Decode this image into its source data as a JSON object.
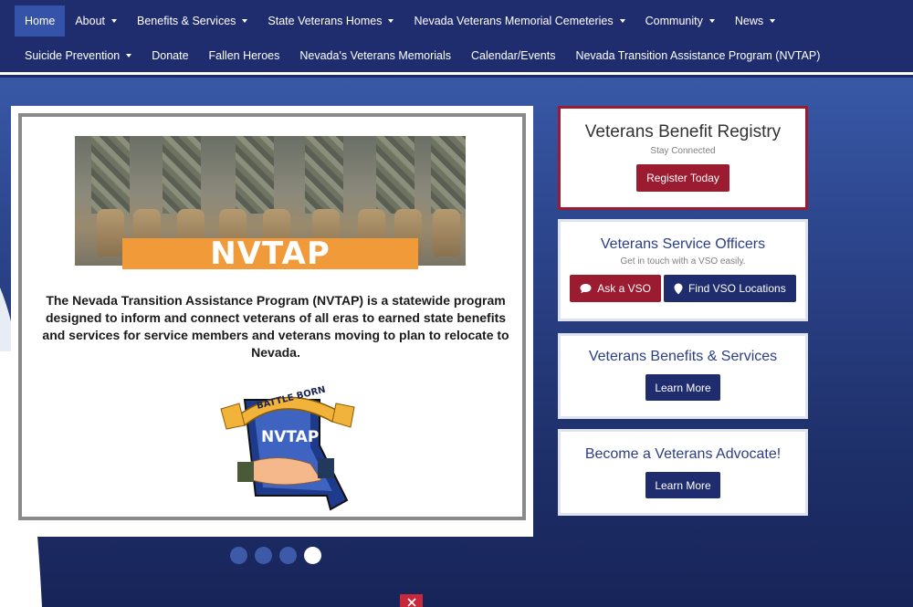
{
  "nav": {
    "row1": [
      {
        "label": "Home",
        "dropdown": false,
        "active": true
      },
      {
        "label": "About",
        "dropdown": true
      },
      {
        "label": "Benefits & Services",
        "dropdown": true
      },
      {
        "label": "State Veterans Homes",
        "dropdown": true
      },
      {
        "label": "Nevada Veterans Memorial Cemeteries",
        "dropdown": true
      },
      {
        "label": "Community",
        "dropdown": true
      },
      {
        "label": "News",
        "dropdown": true
      }
    ],
    "row2": [
      {
        "label": "Suicide Prevention",
        "dropdown": true
      },
      {
        "label": "Donate",
        "dropdown": false
      },
      {
        "label": "Fallen Heroes",
        "dropdown": false
      },
      {
        "label": "Nevada's Veterans Memorials",
        "dropdown": false
      },
      {
        "label": "Calendar/Events",
        "dropdown": false
      },
      {
        "label": "Nevada Transition Assistance Program (NVTAP)",
        "dropdown": false
      }
    ]
  },
  "slide": {
    "banner": "NVTAP",
    "text": "The Nevada Transition Assistance Program (NVTAP) is a statewide program designed to inform and connect veterans of all eras to earned state benefits and services for service members and veterans moving to plan to relocate to Nevada.",
    "logo_arc": "BATTLE BORN",
    "logo_title": "NVTAP",
    "dots_total": 4,
    "dots_active": 4
  },
  "cards": {
    "registry": {
      "title": "Veterans Benefit Registry",
      "sub": "Stay Connected",
      "button": "Register Today"
    },
    "vso": {
      "title": "Veterans Service Officers",
      "sub": "Get in touch with a VSO easily.",
      "button_ask": "Ask a VSO",
      "button_find": "Find VSO Locations"
    },
    "benefits": {
      "title": "Veterans Benefits & Services",
      "button": "Learn More"
    },
    "advocate": {
      "title": "Become a Veterans Advocate!",
      "button": "Learn More"
    }
  },
  "icons": {
    "ask": "chat-bubble-icon",
    "find": "map-marker-icon",
    "close": "close-icon"
  },
  "colors": {
    "nav": "#1f2d6e",
    "active_nav": "#3553a8",
    "accent_red": "#9b1b30",
    "navy_button": "#1f2d6e",
    "banner_orange": "#f09a3a"
  }
}
